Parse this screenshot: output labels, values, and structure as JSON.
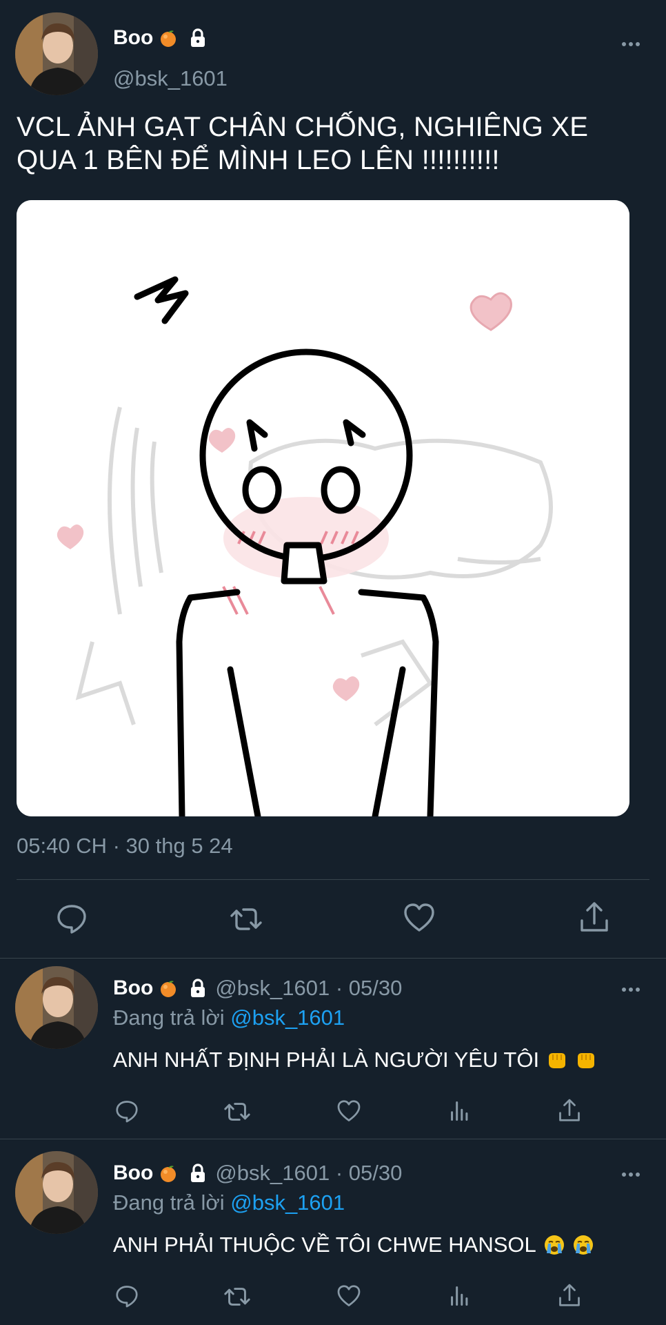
{
  "tweet": {
    "display_name": "Boo",
    "handle": "@bsk_1601",
    "text": "VCL ẢNH GẠT CHÂN CHỐNG, NGHIÊNG XE QUA 1 BÊN ĐỂ MÌNH LEO LÊN !!!!!!!!!!",
    "timestamp": "05:40 CH · 30 thg 5 24",
    "icons": [
      "orange-emoji",
      "lock-icon",
      "more-icon",
      "reply-icon",
      "retweet-icon",
      "like-icon",
      "share-icon"
    ]
  },
  "replies": [
    {
      "display_name": "Boo",
      "handle_date": "@bsk_1601 · 05/30",
      "replying_prefix": "Đang trả lời ",
      "replying_to": "@bsk_1601",
      "text": "ANH NHẤT ĐỊNH PHẢI LÀ NGƯỜI YÊU TÔI",
      "emojis": [
        "oncoming-fist-emoji",
        "oncoming-fist-emoji"
      ]
    },
    {
      "display_name": "Boo",
      "handle_date": "@bsk_1601 · 05/30",
      "replying_prefix": "Đang trả lời ",
      "replying_to": "@bsk_1601",
      "text": "ANH PHẢI THUỘC VỀ TÔI CHWE HANSOL",
      "emojis": [
        "loudly-crying-emoji",
        "loudly-crying-emoji"
      ]
    }
  ],
  "colors": {
    "background": "#15202b",
    "secondary_text": "#8899a6",
    "mention": "#1da1f2",
    "divider": "#38444d"
  }
}
